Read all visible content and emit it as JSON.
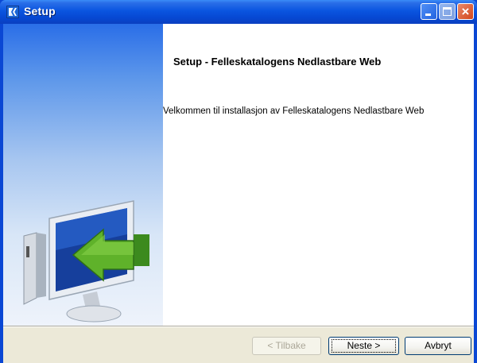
{
  "window": {
    "title": "Setup",
    "controls": {
      "minimize": "minimize",
      "maximize": "maximize",
      "close": "×"
    }
  },
  "content": {
    "heading": "Setup - Felleskatalogens Nedlastbare Web",
    "welcome_text": "Velkommen til installasjon av Felleskatalogens Nedlastbare Web"
  },
  "buttons": {
    "back": "< Tilbake",
    "next": "Neste >",
    "cancel": "Avbryt"
  },
  "icons": {
    "app": "setup-app-icon",
    "illustration": "computer-install-arrow-icon"
  }
}
